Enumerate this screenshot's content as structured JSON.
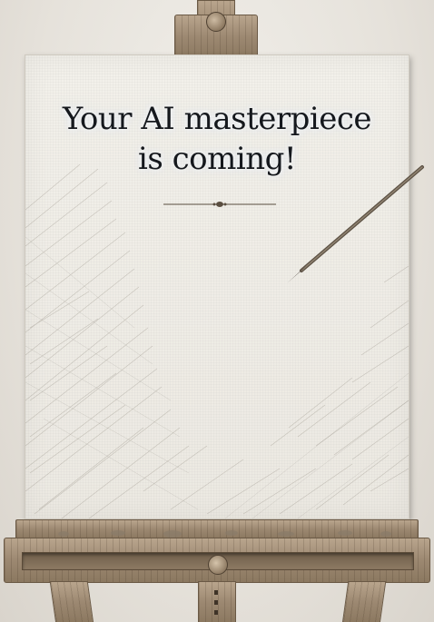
{
  "canvas": {
    "headline_line1": "Your AI masterpiece",
    "headline_line2": "is coming!"
  },
  "colors": {
    "canvas": "#efece6",
    "text": "#15181d",
    "wood": "#9d8a73",
    "pencil": "#4a4036"
  },
  "icons": {
    "divider": "ornamental-divider",
    "pencil": "pencil-icon",
    "knob": "wood-knob"
  }
}
